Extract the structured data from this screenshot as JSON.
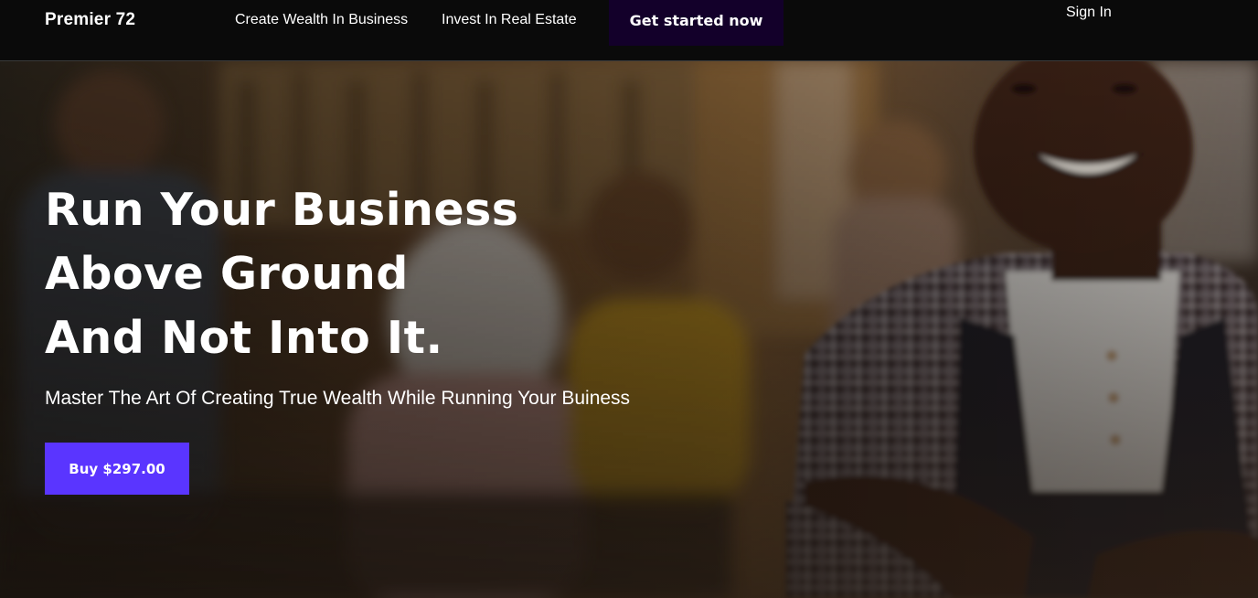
{
  "nav": {
    "brand": "Premier 72",
    "links": [
      {
        "label": "Create Wealth In Business"
      },
      {
        "label": "Invest In Real Estate"
      }
    ],
    "cta_label": "Get started now",
    "signin_label": "Sign In"
  },
  "hero": {
    "title_lines": [
      "Run Your Business",
      "Above Ground",
      "And Not Into It."
    ],
    "subtitle": "Master The Art Of Creating True Wealth While Running Your Buiness",
    "buy_label": "Buy $297.00"
  },
  "colors": {
    "navbar_bg": "#0a0a0a",
    "cta_bg": "#13002a",
    "buy_bg": "#5a35ff",
    "text": "#ffffff"
  },
  "icons": {
    "background": "hero-photo-smiling-man-in-apron"
  }
}
